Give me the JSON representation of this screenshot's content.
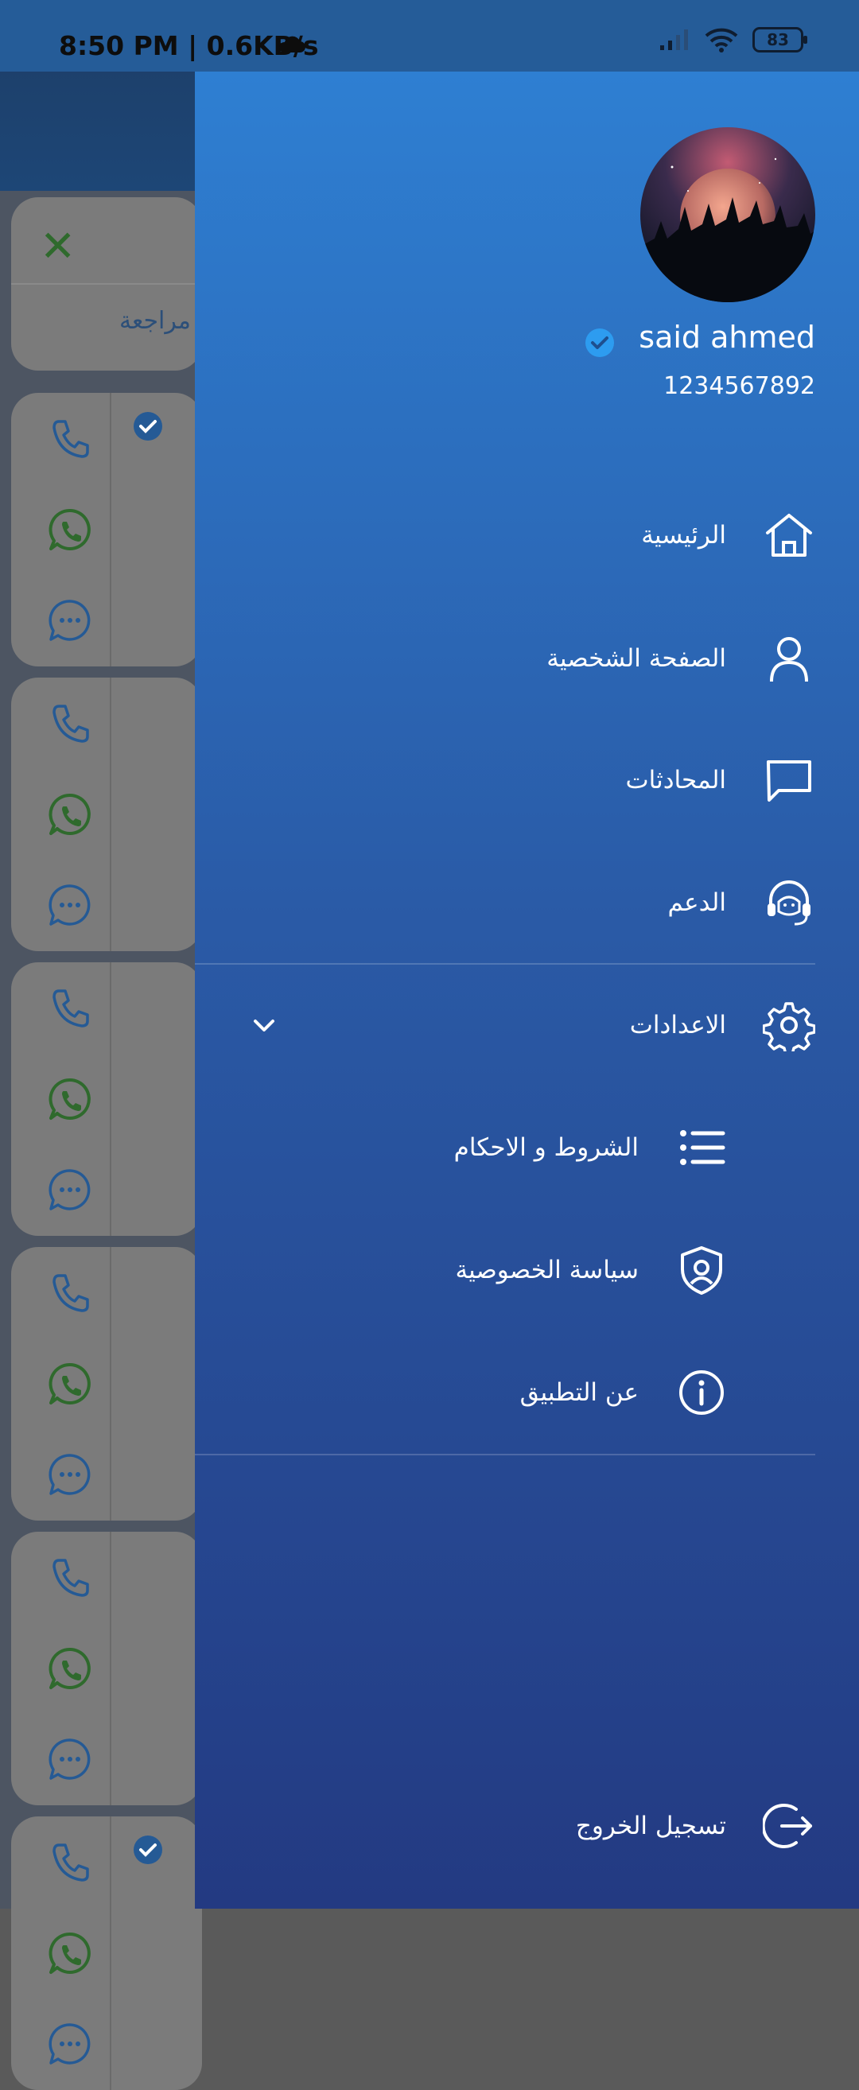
{
  "status_bar": {
    "time_and_speed": "8:50 PM | 0.6KB/s",
    "battery": "83"
  },
  "background": {
    "top_card_label": "مراجعة"
  },
  "drawer": {
    "user": {
      "name": "said ahmed",
      "phone": "1234567892"
    },
    "menu": {
      "home": "الرئيسية",
      "profile": "الصفحة الشخصية",
      "chats": "المحادثات",
      "support": "الدعم",
      "settings": "الاعدادات"
    },
    "settings_submenu": {
      "terms": "الشروط و الاحكام",
      "privacy": "سياسة الخصوصية",
      "about": "عن التطبيق"
    },
    "logout": "تسجيل الخروج"
  },
  "colors": {
    "drawer_top": "#2e7fd2",
    "drawer_bottom": "#233a82",
    "whatsapp_green": "#2f6a2d",
    "icon_blue": "#255a95",
    "verified_blue": "#2d9cf0"
  }
}
